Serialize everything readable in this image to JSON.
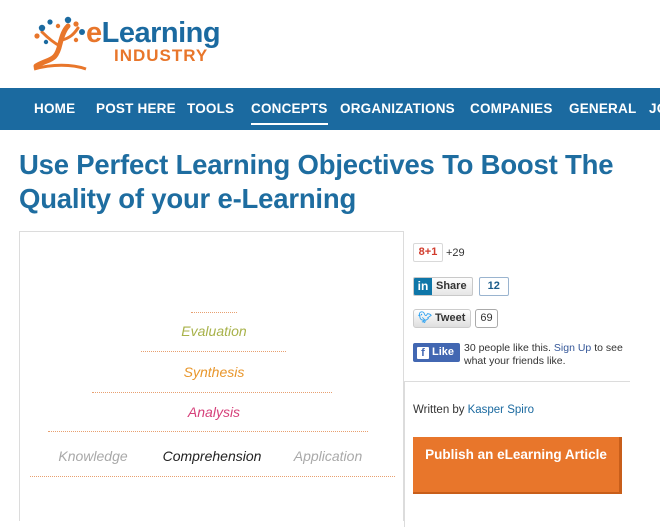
{
  "logo": {
    "text_line1": "eLearning",
    "text_line2": "INDUSTRY",
    "colors": {
      "blue": "#1b6aa0",
      "orange": "#e8762b"
    }
  },
  "nav": {
    "items": [
      {
        "label": "HOME"
      },
      {
        "label": "POST HERE"
      },
      {
        "label": "TOOLS"
      },
      {
        "label": "CONCEPTS",
        "active": true
      },
      {
        "label": "ORGANIZATIONS"
      },
      {
        "label": "COMPANIES"
      },
      {
        "label": "GENERAL"
      },
      {
        "label": "JO"
      }
    ],
    "background": "#1b6aa0"
  },
  "article": {
    "title": "Use Perfect Learning Objectives To Boost The Quality of your e-Learning"
  },
  "pyramid": {
    "levels": [
      {
        "label": "Evaluation",
        "color": "#a8b24a"
      },
      {
        "label": "Synthesis",
        "color": "#e8962b"
      },
      {
        "label": "Analysis",
        "color": "#d6407a"
      }
    ],
    "base": [
      {
        "label": "Knowledge",
        "color": "#a9a9a9"
      },
      {
        "label": "Comprehension",
        "color": "#222222"
      },
      {
        "label": "Application",
        "color": "#a9a9a9"
      }
    ]
  },
  "social": {
    "gplus": {
      "label": "+1",
      "count": "+29"
    },
    "linkedin": {
      "label": "Share",
      "count": "12"
    },
    "twitter": {
      "label": "Tweet",
      "count": "69"
    },
    "facebook": {
      "label": "Like",
      "text_before": "30 people like this.",
      "signup_link": "Sign Up",
      "text_after": "to see what your friends like."
    }
  },
  "byline": {
    "prefix": "Written by",
    "author": "Kasper Spiro"
  },
  "publish_button": {
    "label": "Publish an eLearning Article",
    "color": "#e8762b"
  }
}
